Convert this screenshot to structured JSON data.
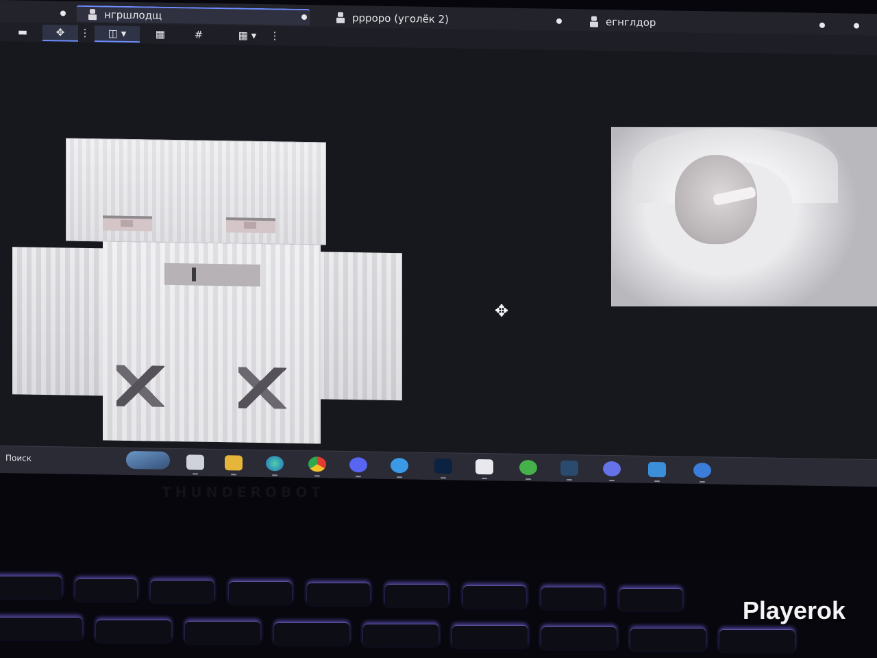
{
  "tabs": [
    {
      "label": "нгршлодщ",
      "active": true
    },
    {
      "label": "ррроро (уголёк 2)",
      "active": false
    },
    {
      "label": "егнглдор",
      "active": false
    }
  ],
  "toolbar": {
    "tools": [
      "layout-icon",
      "move-icon",
      "split-view-icon",
      "grid-icon",
      "hash-grid-icon",
      "panels-icon"
    ]
  },
  "taskbar": {
    "search_label": "Поиск",
    "apps": [
      "file-explorer-icon",
      "folder-icon",
      "edge-icon",
      "chrome-icon",
      "discord-icon",
      "telegram-icon",
      "photoshop-icon",
      "calendar-icon",
      "launcher-icon",
      "steam-icon",
      "discord-alt-icon",
      "screenshot-icon",
      "notification-icon"
    ]
  },
  "keyboard_brand": "THUNDEROBOT",
  "watermark": "Playerok",
  "colors": {
    "accent": "#6d8cff",
    "keyboard_backlight": "#8a70ff"
  }
}
